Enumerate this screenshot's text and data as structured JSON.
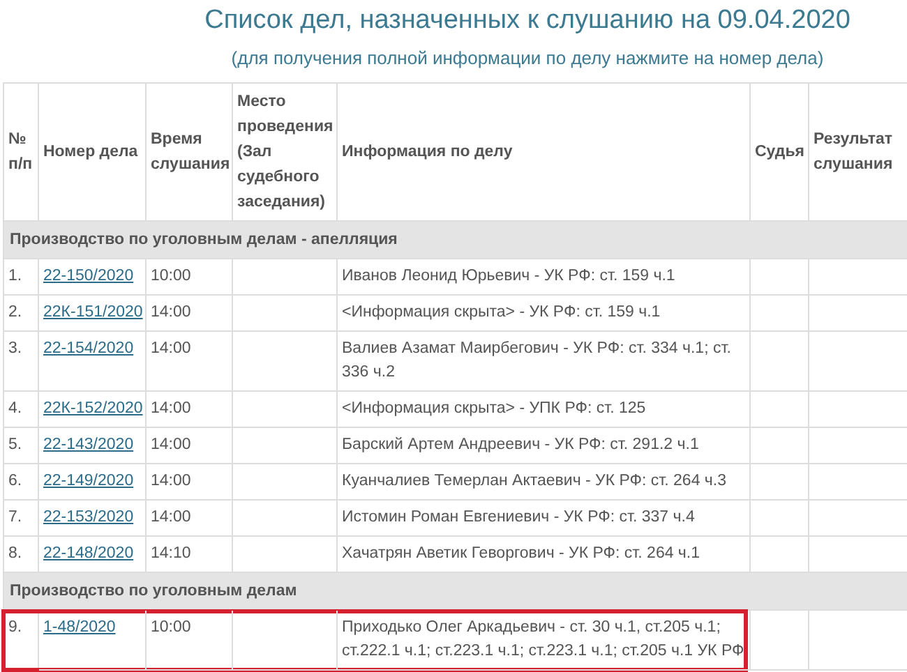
{
  "title": "Список дел, назначенных к слушанию на 09.04.2020",
  "subtitle": "(для получения полной информации по делу нажмите на номер дела)",
  "table": {
    "columns": [
      "№ п/п",
      "Номер дела",
      "Время слушания",
      "Место проведения (Зал судебного заседания)",
      "Информация по делу",
      "Судья",
      "Результат слушания"
    ],
    "sections": [
      {
        "title": "Производство по уголовным делам - апелляция",
        "rows": [
          {
            "num": "1.",
            "case": "22-150/2020",
            "time": "10:00",
            "info": "Иванов Леонид Юрьевич - УК РФ: ст. 159 ч.1",
            "highlighted": false
          },
          {
            "num": "2.",
            "case": "22К-151/2020",
            "time": "14:00",
            "info": "<Информация скрыта> - УК РФ: ст. 159 ч.1",
            "highlighted": false
          },
          {
            "num": "3.",
            "case": "22-154/2020",
            "time": "14:00",
            "info": "Валиев Азамат Маирбегович - УК РФ: ст. 334 ч.1; ст. 336 ч.2",
            "highlighted": false
          },
          {
            "num": "4.",
            "case": "22К-152/2020",
            "time": "14:00",
            "info": "<Информация скрыта> - УПК РФ: ст. 125",
            "highlighted": false
          },
          {
            "num": "5.",
            "case": "22-143/2020",
            "time": "14:00",
            "info": "Барский Артем Андреевич - УК РФ: ст. 291.2 ч.1",
            "highlighted": false
          },
          {
            "num": "6.",
            "case": "22-149/2020",
            "time": "14:00",
            "info": "Куанчалиев Темерлан Актаевич - УК РФ: ст. 264 ч.3",
            "highlighted": false
          },
          {
            "num": "7.",
            "case": "22-153/2020",
            "time": "14:00",
            "info": "Истомин Роман Евгениевич - УК РФ: ст. 337 ч.4",
            "highlighted": false
          },
          {
            "num": "8.",
            "case": "22-148/2020",
            "time": "14:10",
            "info": "Хачатрян Аветик Геворгович - УК РФ: ст. 264 ч.1",
            "highlighted": false
          }
        ]
      },
      {
        "title": "Производство по уголовным делам",
        "rows": [
          {
            "num": "9.",
            "case": "1-48/2020",
            "time": "10:00",
            "info": "Приходько Олег Аркадьевич - ст. 30 ч.1, ст.205 ч.1; ст.222.1 ч.1; ст.223.1 ч.1; ст.223.1 ч.1; ст.205 ч.1 УК РФ",
            "highlighted": true
          }
        ]
      }
    ]
  }
}
